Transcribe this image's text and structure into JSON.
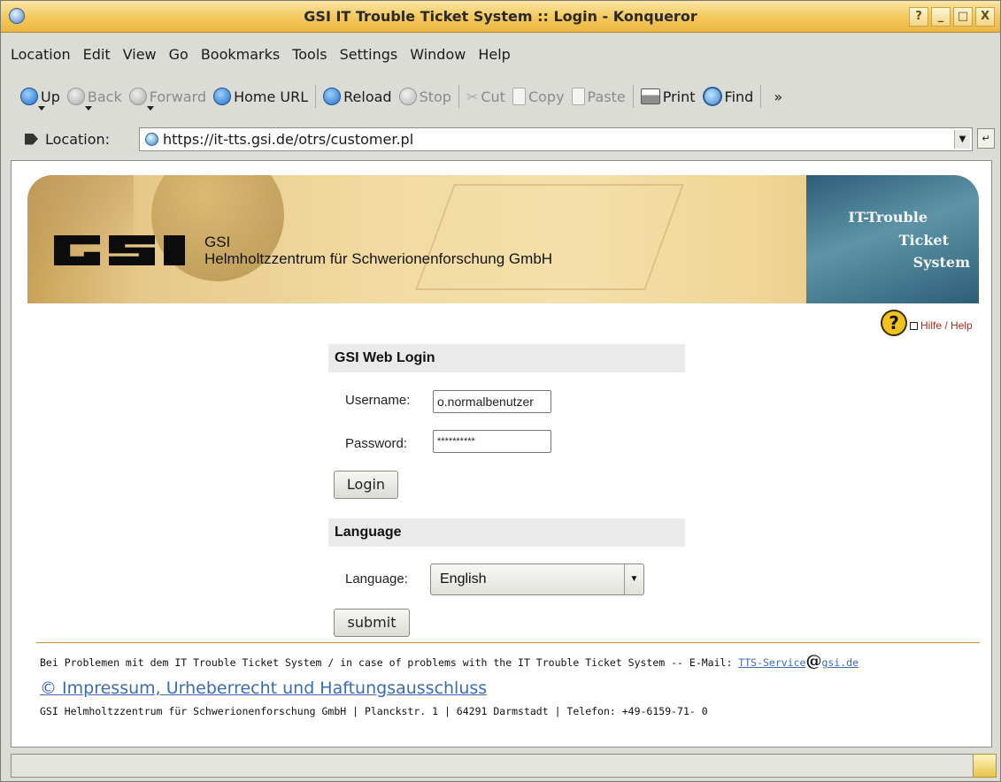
{
  "window": {
    "title": "GSI IT Trouble Ticket System :: Login - Konqueror",
    "buttons": [
      "?",
      "_",
      "□",
      "X"
    ]
  },
  "menu": [
    "Location",
    "Edit",
    "View",
    "Go",
    "Bookmarks",
    "Tools",
    "Settings",
    "Window",
    "Help"
  ],
  "toolbar": {
    "up": "Up",
    "back": "Back",
    "forward": "Forward",
    "home": "Home URL",
    "reload": "Reload",
    "stop": "Stop",
    "cut": "Cut",
    "copy": "Copy",
    "paste": "Paste",
    "print": "Print",
    "find": "Find",
    "more": "»"
  },
  "location": {
    "label": "Location:",
    "url": "https://it-tts.gsi.de/otrs/customer.pl"
  },
  "banner": {
    "gsi_short": "GSI",
    "gsi_long": "Helmholtzzentrum für Schwerionenforschung GmbH",
    "right_line1": "IT-Trouble",
    "right_line2": "Ticket",
    "right_line3": "System"
  },
  "help": {
    "glyph": "?",
    "label": "Hilfe / Help"
  },
  "login": {
    "heading": "GSI Web Login",
    "username_label": "Username:",
    "username_value": "o.normalbenutzer",
    "password_label": "Password:",
    "password_value": "**********",
    "button": "Login"
  },
  "language": {
    "heading": "Language",
    "label": "Language:",
    "selected": "English",
    "button": "submit"
  },
  "footer": {
    "problems_text": "Bei Problemen mit dem IT Trouble Ticket System / in case of problems with the IT Trouble Ticket System -- E-Mail: ",
    "email_user": "TTS-Service",
    "email_at": "@",
    "email_domain": "gsi.de",
    "impressum": "© Impressum, Urheberrecht und Haftungsausschluss",
    "address": "GSI Helmholtzzentrum für Schwerionenforschung GmbH | Planckstr. 1 | 64291 Darmstadt | Telefon: +49-6159-71- 0"
  }
}
